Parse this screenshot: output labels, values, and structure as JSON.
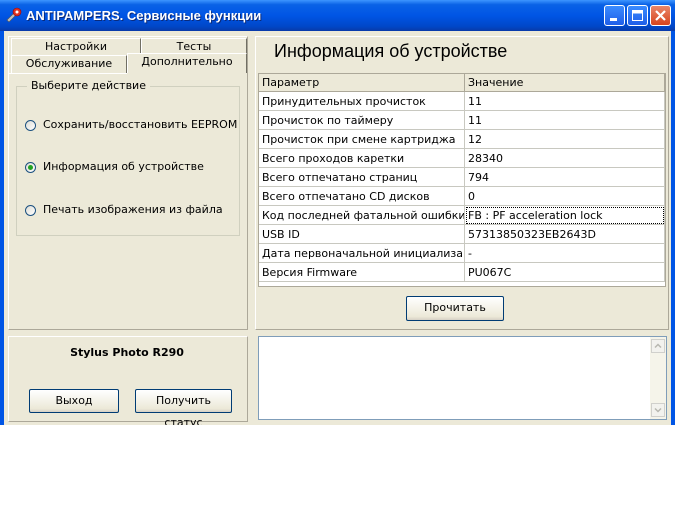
{
  "window": {
    "title": "ANTIPAMPERS. Сервисные функции",
    "title_color": "#0055e5"
  },
  "tabs": {
    "row1": [
      "Настройки",
      "Тесты"
    ],
    "row2": [
      "Обслуживание",
      "Дополнительно"
    ],
    "active": "Дополнительно"
  },
  "actions": {
    "legend": "Выберите действие",
    "options": [
      {
        "label": "Сохранить/восстановить EEPROM",
        "selected": false
      },
      {
        "label": "Информация об устройстве",
        "selected": true
      },
      {
        "label": "Печать изображения из файла",
        "selected": false
      }
    ]
  },
  "device": {
    "model": "Stylus Photo R290"
  },
  "buttons": {
    "exit": "Выход",
    "get_status": "Получить статус",
    "read": "Прочитать"
  },
  "info": {
    "title": "Информация об устройстве",
    "columns": [
      "Параметр",
      "Значение"
    ],
    "rows": [
      [
        "Принудительных прочисток",
        "11"
      ],
      [
        "Прочисток по таймеру",
        "11"
      ],
      [
        "Прочисток при смене картриджа",
        "12"
      ],
      [
        "Всего проходов каретки",
        "28340"
      ],
      [
        "Всего отпечатано страниц",
        "794"
      ],
      [
        "Всего отпечатано CD дисков",
        "0"
      ],
      [
        "Код последней фатальной ошибки принтера",
        "FB : PF acceleration lock"
      ],
      [
        "USB ID",
        "57313850323EB2643D"
      ],
      [
        "Дата первоначальной инициализации",
        "-"
      ],
      [
        "Версия Firmware",
        "PU067C"
      ]
    ],
    "selected_row": 6
  },
  "icons": [
    "app-icon",
    "minimize-icon",
    "maximize-icon",
    "close-icon",
    "scroll-up-icon",
    "scroll-down-icon"
  ]
}
